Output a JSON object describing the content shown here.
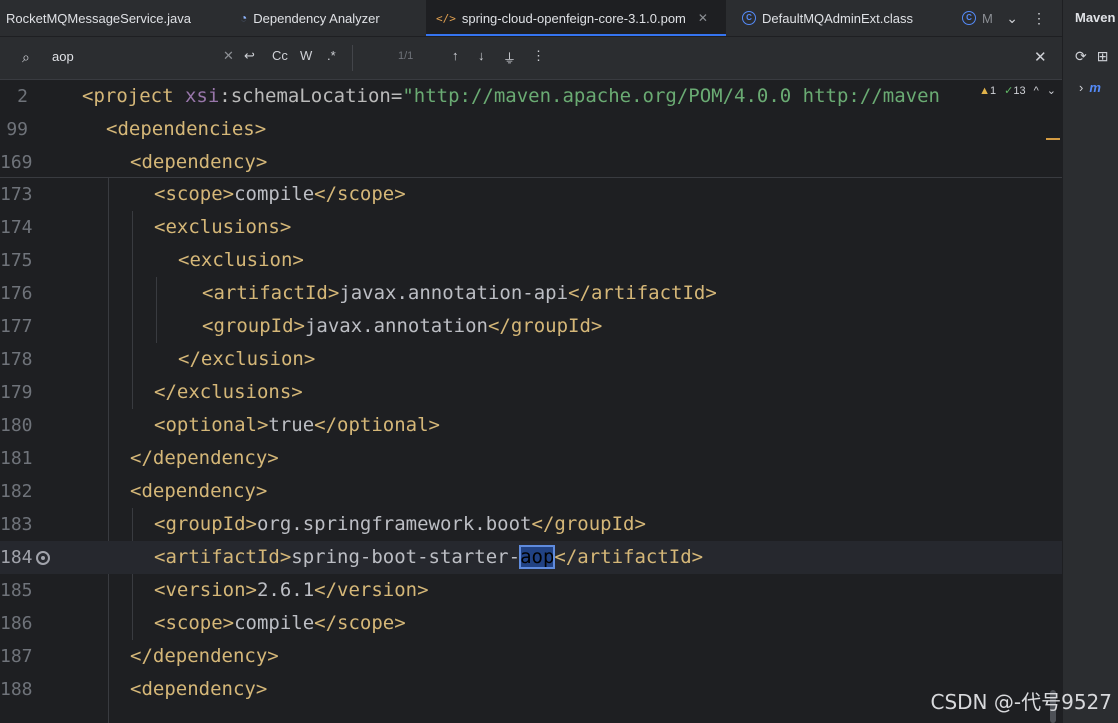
{
  "tabs": [
    {
      "label": "RocketMQMessageService.java",
      "icon": "java-class-icon",
      "active": false
    },
    {
      "label": "Dependency Analyzer",
      "icon": "analyzer-icon",
      "active": false
    },
    {
      "label": "spring-cloud-openfeign-core-3.1.0.pom",
      "icon": "xml-icon",
      "active": true
    },
    {
      "label": "DefaultMQAdminExt.class",
      "icon": "class-icon",
      "active": false
    },
    {
      "label": "M",
      "icon": "class-icon",
      "active": false
    }
  ],
  "search": {
    "value": "aop",
    "match_case": "Cc",
    "words": "W",
    "regex": ".*",
    "count": "1/1"
  },
  "inspections": {
    "warnings": "1",
    "weak": "13"
  },
  "sticky": [
    {
      "num": "2",
      "indent": 0,
      "parts": [
        [
          "tag",
          "<project "
        ],
        [
          "ns",
          "xsi"
        ],
        [
          "attr",
          ":schemaLocation="
        ],
        [
          "val",
          "\"http://maven.apache.org/POM/4.0.0 http://maven"
        ]
      ]
    },
    {
      "num": "99",
      "indent": 1,
      "parts": [
        [
          "tag",
          "<dependencies>"
        ]
      ]
    },
    {
      "num": "169",
      "indent": 2,
      "parts": [
        [
          "tag",
          "<dependency>"
        ]
      ]
    }
  ],
  "lines": [
    {
      "num": "173",
      "indent": 3,
      "parts": [
        [
          "tag",
          "<scope>"
        ],
        [
          "txt",
          "compile"
        ],
        [
          "tag",
          "</scope>"
        ]
      ]
    },
    {
      "num": "174",
      "indent": 3,
      "parts": [
        [
          "tag",
          "<exclusions>"
        ]
      ]
    },
    {
      "num": "175",
      "indent": 4,
      "parts": [
        [
          "tag",
          "<exclusion>"
        ]
      ]
    },
    {
      "num": "176",
      "indent": 5,
      "parts": [
        [
          "tag",
          "<artifactId>"
        ],
        [
          "txt",
          "javax.annotation-api"
        ],
        [
          "tag",
          "</artifactId>"
        ]
      ]
    },
    {
      "num": "177",
      "indent": 5,
      "parts": [
        [
          "tag",
          "<groupId>"
        ],
        [
          "txt",
          "javax.annotation"
        ],
        [
          "tag",
          "</groupId>"
        ]
      ]
    },
    {
      "num": "178",
      "indent": 4,
      "parts": [
        [
          "tag",
          "</exclusion>"
        ]
      ]
    },
    {
      "num": "179",
      "indent": 3,
      "parts": [
        [
          "tag",
          "</exclusions>"
        ]
      ]
    },
    {
      "num": "180",
      "indent": 3,
      "parts": [
        [
          "tag",
          "<optional>"
        ],
        [
          "txt",
          "true"
        ],
        [
          "tag",
          "</optional>"
        ]
      ]
    },
    {
      "num": "181",
      "indent": 2,
      "parts": [
        [
          "tag",
          "</dependency>"
        ]
      ]
    },
    {
      "num": "182",
      "indent": 2,
      "parts": [
        [
          "tag",
          "<dependency>"
        ]
      ]
    },
    {
      "num": "183",
      "indent": 3,
      "parts": [
        [
          "tag",
          "<groupId>"
        ],
        [
          "txt",
          "org.springframework.boot"
        ],
        [
          "tag",
          "</groupId>"
        ]
      ]
    },
    {
      "num": "184",
      "indent": 3,
      "current": true,
      "parts": [
        [
          "tag",
          "<artifactId>"
        ],
        [
          "txt",
          "spring-boot-starter-"
        ],
        [
          "hl",
          "aop"
        ],
        [
          "tag",
          "</artifactId>"
        ]
      ]
    },
    {
      "num": "185",
      "indent": 3,
      "parts": [
        [
          "tag",
          "<version>"
        ],
        [
          "txt",
          "2.6.1"
        ],
        [
          "tag",
          "</version>"
        ]
      ]
    },
    {
      "num": "186",
      "indent": 3,
      "parts": [
        [
          "tag",
          "<scope>"
        ],
        [
          "txt",
          "compile"
        ],
        [
          "tag",
          "</scope>"
        ]
      ]
    },
    {
      "num": "187",
      "indent": 2,
      "parts": [
        [
          "tag",
          "</dependency>"
        ]
      ]
    },
    {
      "num": "188",
      "indent": 2,
      "parts": [
        [
          "tag",
          "<dependency>"
        ]
      ]
    }
  ],
  "maven": {
    "title": "Maven",
    "tree_label": "m"
  },
  "watermark": "CSDN @-代号9527",
  "colors": {
    "accent": "#3574f0",
    "tag": "#d5b778",
    "string": "#6aab73",
    "highlight": "#214283"
  }
}
